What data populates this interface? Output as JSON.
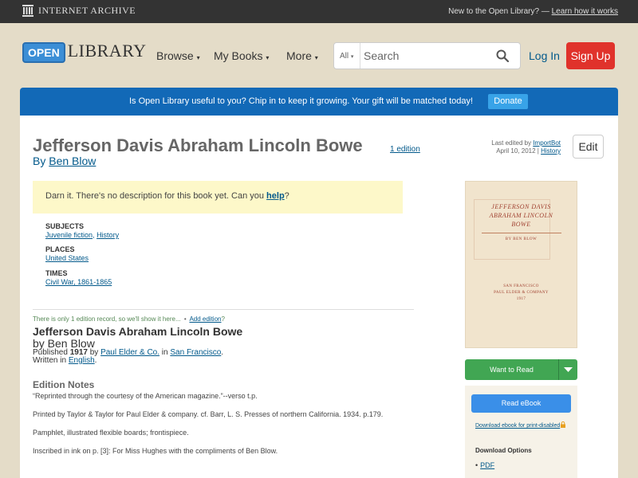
{
  "topbar": {
    "brand": "Internet Archive",
    "promo_text": "New to the Open Library? —",
    "promo_link": "Learn how it works"
  },
  "header": {
    "logo_open": "OPEN",
    "logo_library": "LIBRARY",
    "nav": [
      {
        "label": "Browse"
      },
      {
        "label": "My Books"
      },
      {
        "label": "More"
      }
    ],
    "search": {
      "scope": "All",
      "placeholder": "Search"
    },
    "login_label": "Log In",
    "signup_label": "Sign Up"
  },
  "banner": {
    "text": "Is Open Library useful to you? Chip in to keep it growing. Your gift will be matched today!",
    "button_label": "Donate",
    "color": "#1269b7"
  },
  "work": {
    "title": "Jefferson Davis Abraham Lincoln Bowe",
    "edition_count": "1 edition",
    "by_prefix": "By",
    "author": "Ben Blow",
    "last_edited_prefix": "Last edited by",
    "last_edited_by": "ImportBot",
    "last_edited_date": "April 10, 2012 |",
    "history_label": "History",
    "edit_label": "Edit",
    "description": {
      "text": "Darn it. There's no description for this book yet. Can you",
      "link": "help",
      "suffix": "?"
    },
    "facets": [
      {
        "label": "SUBJECTS",
        "values": [
          "Juvenile fiction",
          "History"
        ]
      },
      {
        "label": "PLACES",
        "values": [
          "United States"
        ]
      },
      {
        "label": "TIMES",
        "values": [
          "Civil War, 1861-1865"
        ]
      }
    ]
  },
  "edition": {
    "notice": "There is only 1 edition record, so we'll show it here...",
    "notice_sep": "•",
    "add_edition": "Add edition",
    "add_edition_suffix": "?",
    "title": "Jefferson Davis Abraham Lincoln Bowe",
    "by": "by Ben Blow",
    "published_prefix": "Published",
    "year": "1917",
    "by_word": "by",
    "publisher": "Paul Elder & Co.",
    "in_word": "in",
    "place": "San Francisco",
    "period": ".",
    "written_prefix": "Written in",
    "language": "English",
    "notes_heading": "Edition Notes",
    "notes": [
      "“Reprinted through the courtesy of the American magazine.”--verso t.p.",
      "Printed by Taylor & Taylor for Paul Elder & company. cf. Barr, L. S. Presses of northern California. 1934. p.179.",
      "Pamphlet, illustrated flexible boards; frontispiece.",
      "Inscribed in ink on p. [3]: For Miss Hughes with the compliments of Ben Blow."
    ]
  },
  "cover": {
    "title_line1": "JEFFERSON DAVIS",
    "title_line2": "ABRAHAM LINCOLN",
    "title_line3": "BOWE",
    "author": "BY BEN BLOW",
    "publisher_line1": "SAN FRANCISCO",
    "publisher_line2": "PAUL ELDER & COMPANY",
    "publisher_line3": "1917"
  },
  "actions": {
    "want_to_read": "Want to Read",
    "read_ebook": "Read eBook",
    "download_print_disabled": "Download ebook for print-disabled",
    "download_heading": "Download Options",
    "download_bullet": "•",
    "download_pdf": "PDF"
  },
  "colors": {
    "signup": "#e0322b",
    "want_to_read": "#41a653",
    "read_ebook": "#3a8fe8",
    "link": "#02598b"
  }
}
